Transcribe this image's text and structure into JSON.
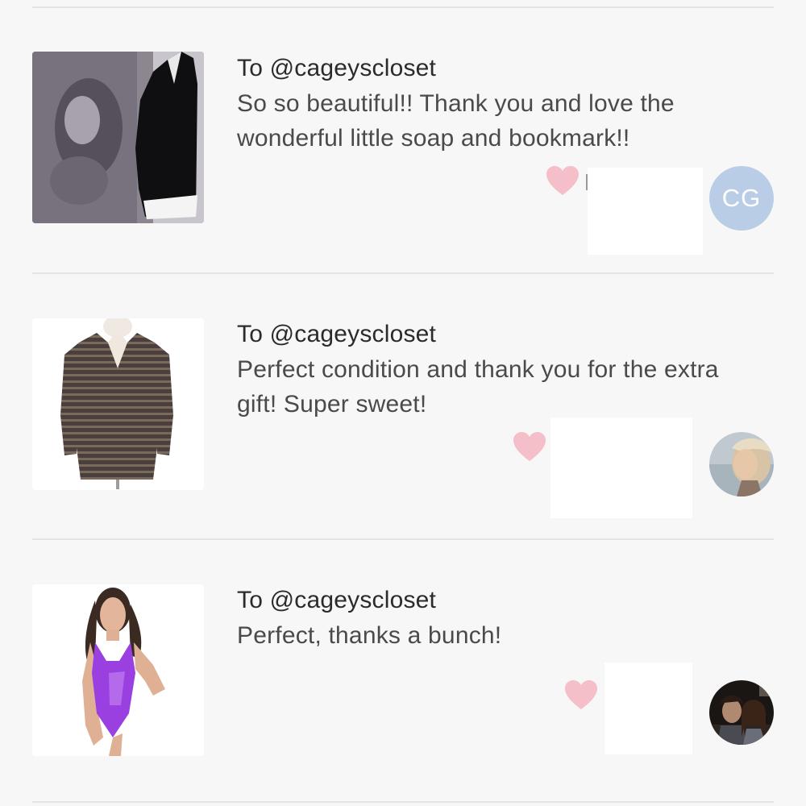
{
  "feed": {
    "items": [
      {
        "product_image": "black-wrap-dress-photo",
        "recipient": "To @cageyscloset",
        "comment": "So so beautiful!! Thank you and love the wonderful little soap and bookmark!!",
        "like_icon": "heart-icon",
        "avatar_initials": "CG"
      },
      {
        "product_image": "striped-knit-sweater-photo",
        "recipient": "To @cageyscloset",
        "comment": "Perfect condition and thank you for the extra gift! Super sweet!",
        "like_icon": "heart-icon",
        "avatar": "user-photo-avatar"
      },
      {
        "product_image": "purple-swimsuit-photo",
        "recipient": "To @cageyscloset",
        "comment": "Perfect, thanks a bunch!",
        "like_icon": "heart-icon",
        "avatar": "user-photo-avatar"
      }
    ]
  },
  "colors": {
    "background": "#f7f7f8",
    "divider": "#e6e3e6",
    "heart": "#f5bfc9",
    "initials_avatar": "#b9cde6",
    "recipient_text": "#2b2b2b",
    "comment_text": "#4a4a4a"
  }
}
